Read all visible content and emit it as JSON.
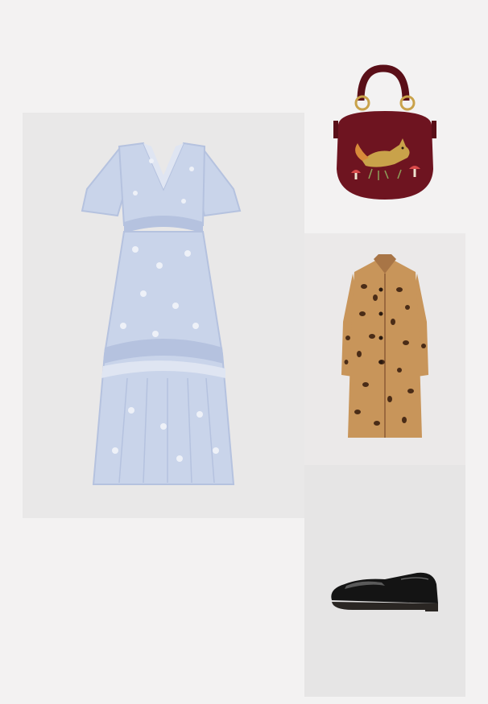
{
  "outfit": {
    "items": [
      {
        "product": "dress",
        "description_color": "pale blue floral ruffle midi dress",
        "bg": "#e9e8e8"
      },
      {
        "product": "handbag",
        "description_color": "burgundy velvet saddle bag with embroidered fox",
        "bg": "#f3f2f2"
      },
      {
        "product": "coat",
        "description_color": "leopard print coat",
        "bg": "#ebe9e9"
      },
      {
        "product": "loafers",
        "description_color": "black patent loafers",
        "bg": "#e6e5e5"
      }
    ]
  },
  "colors": {
    "page_bg": "#f3f2f2",
    "dress": "#c9d4ea",
    "dress_shade": "#b5c2df",
    "bag": "#6e1420",
    "bag_handle": "#5a0f18",
    "bag_hardware": "#c9a24a",
    "coat_base": "#c8955a",
    "coat_spot": "#4a2c17",
    "shoe": "#141414"
  }
}
